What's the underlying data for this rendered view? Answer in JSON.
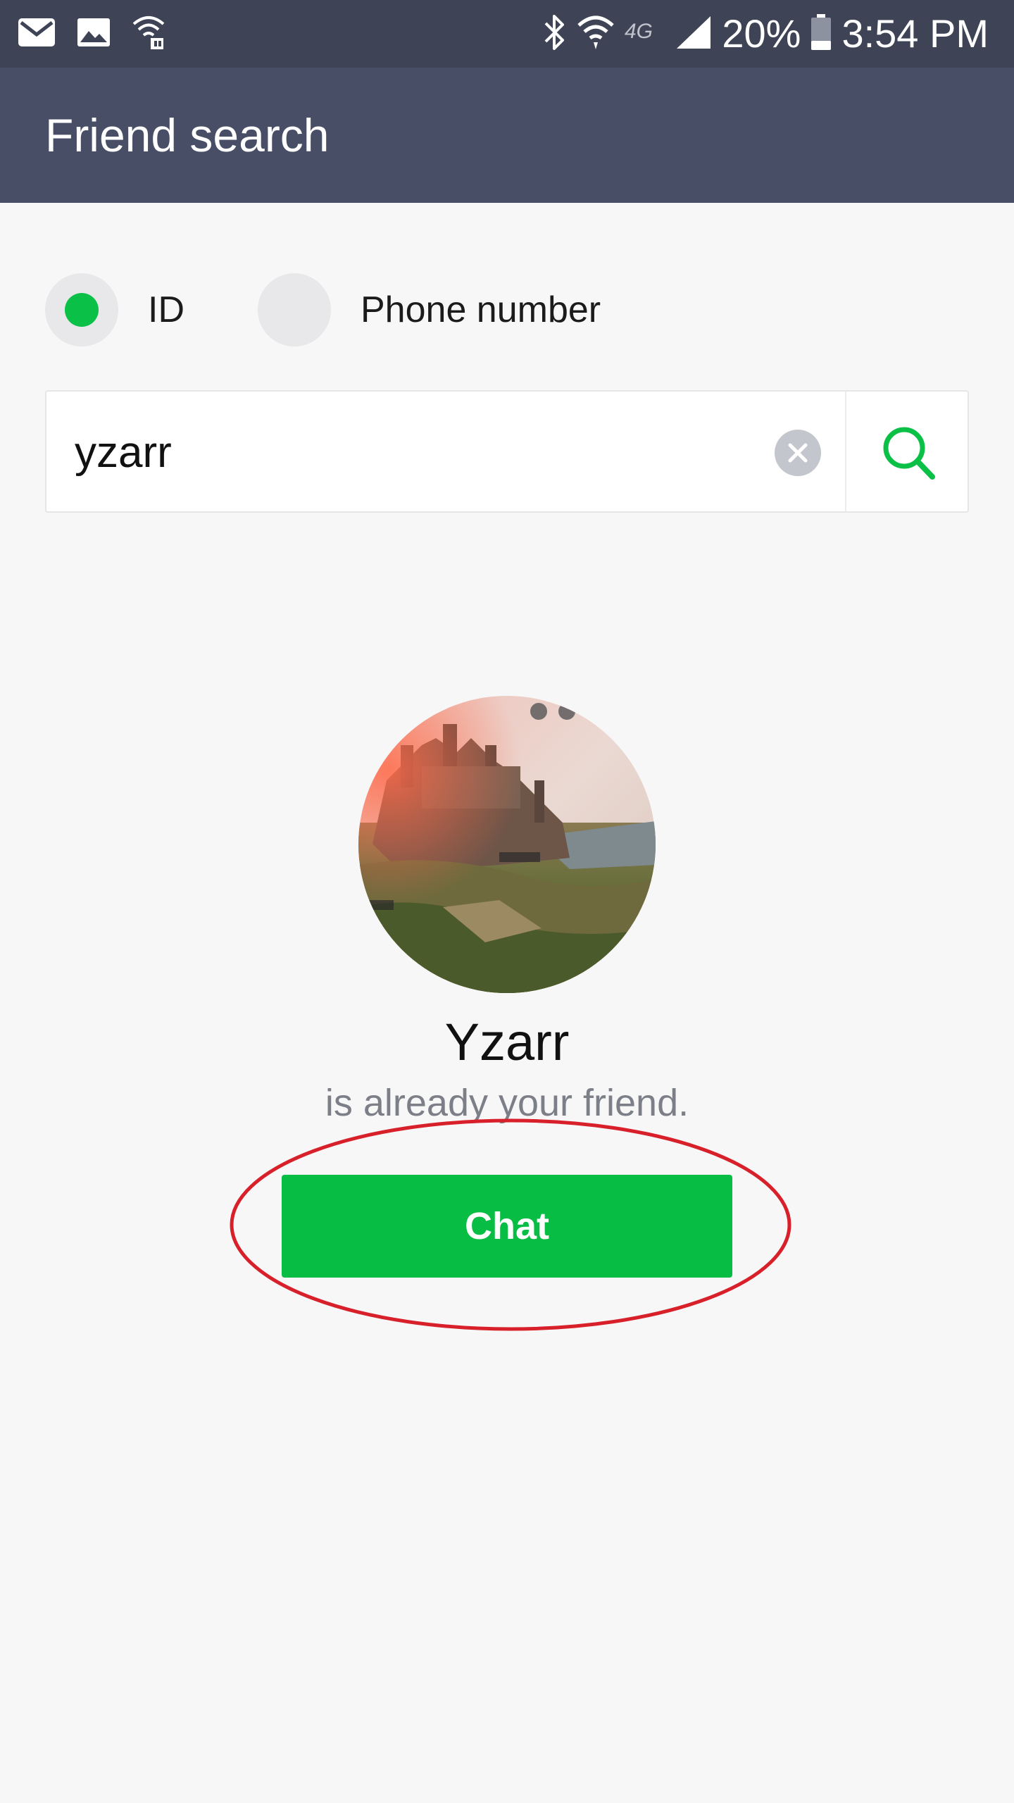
{
  "status_bar": {
    "battery_percent": "20%",
    "time": "3:54 PM",
    "network_label": "4G",
    "left_icons": [
      "email-icon",
      "image-icon",
      "wifi-download-icon"
    ],
    "right_icons": [
      "bluetooth-icon",
      "wifi-icon",
      "signal-icon",
      "battery-icon"
    ]
  },
  "header": {
    "title": "Friend search"
  },
  "search_type": {
    "options": [
      {
        "label": "ID",
        "selected": true
      },
      {
        "label": "Phone number",
        "selected": false
      }
    ]
  },
  "search": {
    "value": "yzarr",
    "clear_icon": "close-circle-icon",
    "search_icon": "search-icon"
  },
  "result": {
    "name": "Yzarr",
    "status": "is already your friend.",
    "chat_label": "Chat"
  },
  "colors": {
    "status_bar": "#3e4456",
    "header": "#474e66",
    "accent_green": "#07bd44",
    "highlight_red": "#d8202a"
  }
}
